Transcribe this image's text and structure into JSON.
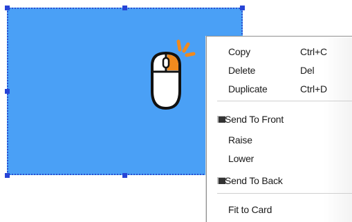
{
  "colors": {
    "shape_fill": "#4aa0f6",
    "selection_handles": "#2744d6",
    "mouse_accent": "#f08a1e"
  },
  "canvas": {
    "mouse_icon": "mouse-right-click-icon"
  },
  "context_menu": {
    "items": [
      {
        "label": "Copy",
        "shortcut": "Ctrl+C"
      },
      {
        "label": "Delete",
        "shortcut": "Del"
      },
      {
        "label": "Duplicate",
        "shortcut": "Ctrl+D"
      },
      {
        "label": "Send To Front",
        "icon": "send-to-front-icon"
      },
      {
        "label": "Raise"
      },
      {
        "label": "Lower"
      },
      {
        "label": "Send To Back",
        "icon": "send-to-back-icon"
      },
      {
        "label": "Fit to Card"
      }
    ]
  }
}
